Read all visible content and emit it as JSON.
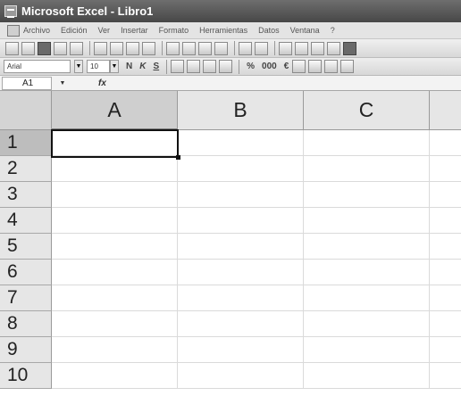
{
  "window": {
    "title": "Microsoft Excel - Libro1"
  },
  "menu": [
    "Archivo",
    "Edición",
    "Ver",
    "Insertar",
    "Formato",
    "Herramientas",
    "Datos",
    "Ventana",
    "?"
  ],
  "toolbar": {
    "standard_icons": [
      "new-icon",
      "open-icon",
      "save-icon",
      "permission-icon",
      "email-icon",
      "print-icon",
      "print-preview-icon",
      "spelling-icon",
      "research-icon",
      "cut-icon",
      "copy-icon",
      "paste-icon",
      "format-painter-icon",
      "undo-icon",
      "redo-icon",
      "hyperlink-icon",
      "autosum-icon",
      "sort-ascending-icon",
      "sort-descending-icon",
      "chart-wizard-icon"
    ],
    "font": "Arial",
    "font_size": "10",
    "bold": "N",
    "italic": "K",
    "underline": "S",
    "percent": "%",
    "thousands": "000",
    "currency": "€"
  },
  "formula_bar": {
    "name_box": "A1",
    "fx": "fx",
    "value": ""
  },
  "sheet": {
    "columns": [
      "A",
      "B",
      "C"
    ],
    "rows": [
      "1",
      "2",
      "3",
      "4",
      "5",
      "6",
      "7",
      "8",
      "9",
      "10"
    ],
    "active_cell": "A1"
  }
}
